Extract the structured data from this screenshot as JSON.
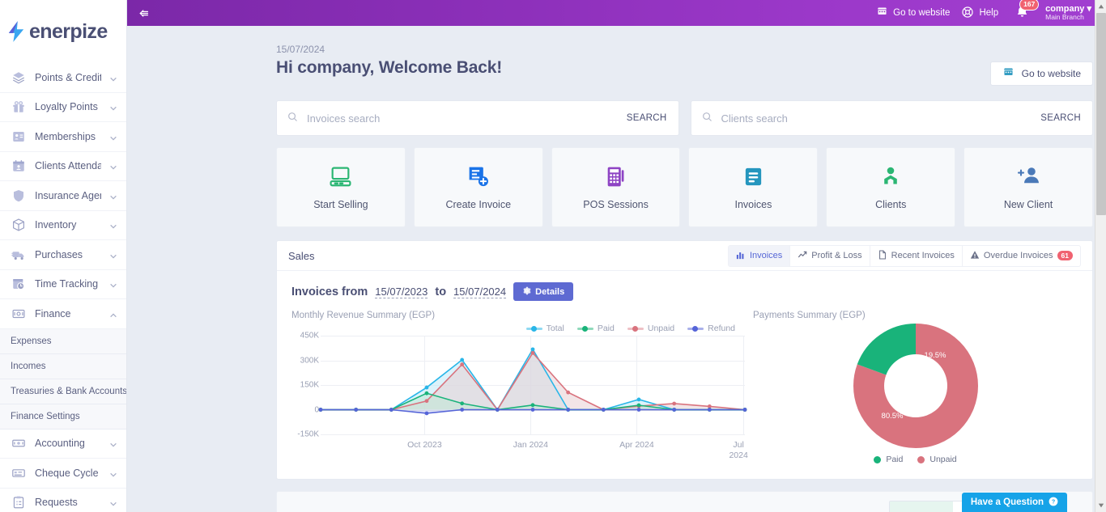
{
  "brand": {
    "name": "enerpize",
    "logo_icon": "bolt-icon"
  },
  "sidebar": {
    "items": [
      {
        "label": "Points & Credits",
        "icon": "layers-icon"
      },
      {
        "label": "Loyalty Points",
        "icon": "gift-icon"
      },
      {
        "label": "Memberships",
        "icon": "id-card-icon"
      },
      {
        "label": "Clients Attendance",
        "icon": "calendar-user-icon"
      },
      {
        "label": "Insurance Agents",
        "icon": "shield-icon"
      },
      {
        "label": "Inventory",
        "icon": "box-icon"
      },
      {
        "label": "Purchases",
        "icon": "truck-icon"
      },
      {
        "label": "Time Tracking",
        "icon": "clock-calendar-icon"
      },
      {
        "label": "Finance",
        "icon": "safe-icon",
        "expanded": true
      },
      {
        "label": "Accounting",
        "icon": "cash-icon"
      },
      {
        "label": "Cheque Cycle",
        "icon": "cheque-icon"
      },
      {
        "label": "Requests",
        "icon": "clipboard-icon"
      }
    ],
    "finance_submenu": [
      {
        "label": "Expenses"
      },
      {
        "label": "Incomes"
      },
      {
        "label": "Treasuries & Bank Accounts"
      },
      {
        "label": "Finance Settings"
      }
    ]
  },
  "topbar": {
    "collapse_icon": "collapse-left-icon",
    "go_to_website": "Go to website",
    "go_to_website_icon": "storefront-icon",
    "help": "Help",
    "help_icon": "lifebuoy-icon",
    "notifications_icon": "bell-icon",
    "notifications_count": "167",
    "account_name": "company",
    "account_branch": "Main Branch",
    "account_caret_icon": "caret-down-icon",
    "accent_color": "#8b2fb8"
  },
  "header": {
    "date": "15/07/2024",
    "welcome_bold": "Hi company,",
    "welcome_rest": " Welcome Back!",
    "go_to_website_button": "Go to website",
    "go_to_website_icon": "storefront-icon"
  },
  "search": {
    "invoices": {
      "placeholder": "Invoices search",
      "value": "",
      "button": "SEARCH",
      "icon": "search-icon"
    },
    "clients": {
      "placeholder": "Clients search",
      "value": "",
      "button": "SEARCH",
      "icon": "search-icon"
    }
  },
  "quick_cards": [
    {
      "label": "Start Selling",
      "icon": "monitor-icon",
      "color": "#2bb673"
    },
    {
      "label": "Create Invoice",
      "icon": "invoice-add-icon",
      "color": "#1a73e8"
    },
    {
      "label": "POS Sessions",
      "icon": "pos-terminal-icon",
      "color": "#8e44c4"
    },
    {
      "label": "Invoices",
      "icon": "document-lines-icon",
      "color": "#2596be"
    },
    {
      "label": "Clients",
      "icon": "person-group-icon",
      "color": "#2bb673"
    },
    {
      "label": "New Client",
      "icon": "person-add-icon",
      "color": "#4a79b8"
    }
  ],
  "sales_panel": {
    "title": "Sales",
    "tabs": [
      {
        "label": "Invoices",
        "icon": "bar-chart-icon",
        "active": true
      },
      {
        "label": "Profit & Loss",
        "icon": "trend-line-icon",
        "active": false
      },
      {
        "label": "Recent Invoices",
        "icon": "file-icon",
        "active": false
      },
      {
        "label": "Overdue Invoices",
        "icon": "warning-icon",
        "active": false,
        "badge": "61"
      }
    ],
    "range_prefix": "Invoices from",
    "range_from": "15/07/2023",
    "range_middle": "to",
    "range_to": "15/07/2024",
    "details_button": "Details",
    "details_icon": "gear-icon"
  },
  "chart_data": [
    {
      "type": "line",
      "title": "Monthly Revenue Summary (EGP)",
      "xlabel": "",
      "ylabel": "",
      "ylim": [
        -150000,
        450000
      ],
      "yticks": [
        450000,
        300000,
        150000,
        0,
        -150000
      ],
      "ytick_labels": [
        "450K",
        "300K",
        "150K",
        "0",
        "-150K"
      ],
      "grid": true,
      "legend_position": "top-right",
      "x": [
        "Jul 2023",
        "Aug 2023",
        "Sep 2023",
        "Oct 2023",
        "Nov 2023",
        "Dec 2023",
        "Jan 2024",
        "Feb 2024",
        "Mar 2024",
        "Apr 2024",
        "May 2024",
        "Jun 2024",
        "Jul 2024"
      ],
      "xtick_labels": [
        "Oct 2023",
        "Jan 2024",
        "Apr 2024",
        "Jul 2024"
      ],
      "series": [
        {
          "name": "Total",
          "color": "#29b6e8",
          "fill": "#bfe9f8",
          "values": [
            0,
            0,
            0,
            135000,
            303000,
            0,
            367000,
            0,
            0,
            62000,
            0,
            0,
            0
          ]
        },
        {
          "name": "Paid",
          "color": "#19b37a",
          "fill": "#bfe8d6",
          "values": [
            0,
            0,
            0,
            100000,
            38000,
            0,
            28000,
            0,
            0,
            27000,
            0,
            0,
            0
          ]
        },
        {
          "name": "Unpaid",
          "color": "#d9737e",
          "fill": "#e8d0d3",
          "values": [
            0,
            0,
            0,
            53000,
            275000,
            0,
            345000,
            105000,
            0,
            22000,
            37000,
            20000,
            0
          ]
        },
        {
          "name": "Refund",
          "color": "#5564d8",
          "fill": "#c9cdf0",
          "values": [
            0,
            0,
            0,
            -22000,
            0,
            0,
            0,
            0,
            0,
            0,
            0,
            0,
            0
          ]
        }
      ]
    },
    {
      "type": "pie",
      "title": "Payments Summary (EGP)",
      "donut": true,
      "labels": [
        "Paid",
        "Unpaid"
      ],
      "values": [
        19.5,
        80.5
      ],
      "value_labels": [
        "19.5%",
        "80.5%"
      ],
      "colors": [
        "#19b37a",
        "#d9737e"
      ],
      "legend_position": "bottom"
    }
  ],
  "widgets": {
    "question_button": "Have a Question",
    "question_icon": "question-circle-icon"
  },
  "scrollbar": {
    "up_icon": "caret-up-icon",
    "down_icon": "caret-down-icon"
  }
}
